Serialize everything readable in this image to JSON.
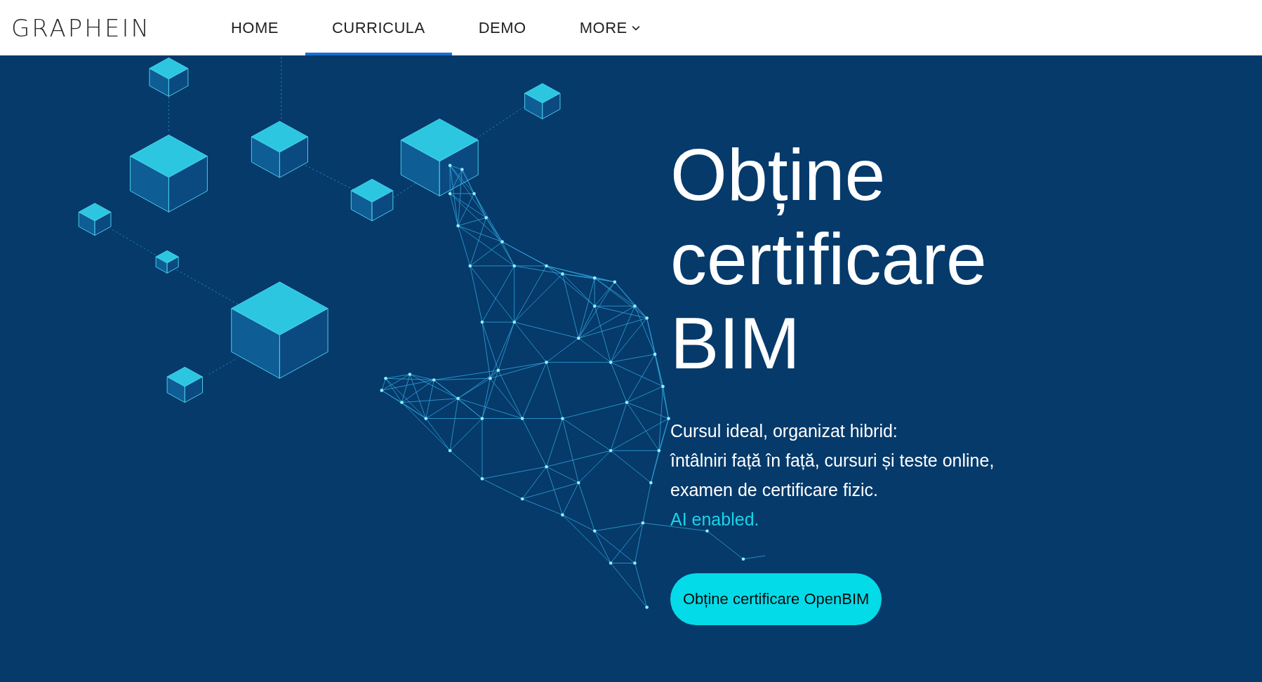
{
  "logo": {
    "text": "GRAPHEIN"
  },
  "nav": [
    {
      "label": "HOME",
      "selected": false,
      "kind": "link"
    },
    {
      "label": "CURRICULA",
      "selected": true,
      "kind": "link"
    },
    {
      "label": "DEMO",
      "selected": false,
      "kind": "link"
    },
    {
      "label": "MORE",
      "selected": false,
      "kind": "dropdown"
    }
  ],
  "hero": {
    "title": "Obține certificare BIM",
    "description_lines": [
      "Cursul ideal, organizat hibrid:",
      "întâlniri față în față, cursuri și teste online,",
      "examen de certificare fizic."
    ],
    "highlight": "AI enabled.",
    "button": "Obține certificare OpenBIM"
  }
}
